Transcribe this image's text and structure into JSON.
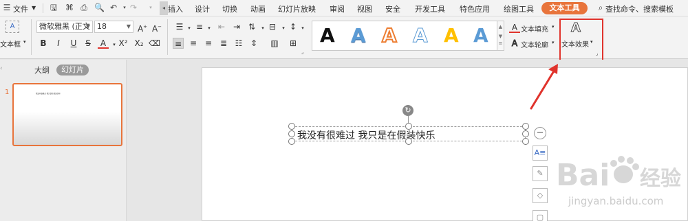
{
  "menubar": {
    "file_label": "文件",
    "tabs": [
      "插入",
      "设计",
      "切换",
      "动画",
      "幻灯片放映",
      "审阅",
      "视图",
      "安全",
      "开发工具",
      "特色应用",
      "绘图工具"
    ],
    "active_tab": "文本工具",
    "search_text": "查找命令、搜索模板"
  },
  "ribbon": {
    "textbox_label": "文本框",
    "font_name": "微软雅黑 (正文",
    "font_size": "18",
    "wordart_letter": "A",
    "text_fill_label": "文本填充",
    "text_outline_label": "文本轮廓",
    "text_effect_label": "文本效果",
    "colors": {
      "accent": "#e8743b",
      "highlight": "#e0332c",
      "wa_blue": "#5b9bd5",
      "wa_orange": "#ed7d31",
      "wa_yellow": "#ffc000"
    }
  },
  "leftpanel": {
    "outline_tab": "大纲",
    "slides_tab": "幻灯片",
    "slide_number": "1"
  },
  "slide": {
    "text": "我没有很难过 我只是在假装快乐"
  }
}
